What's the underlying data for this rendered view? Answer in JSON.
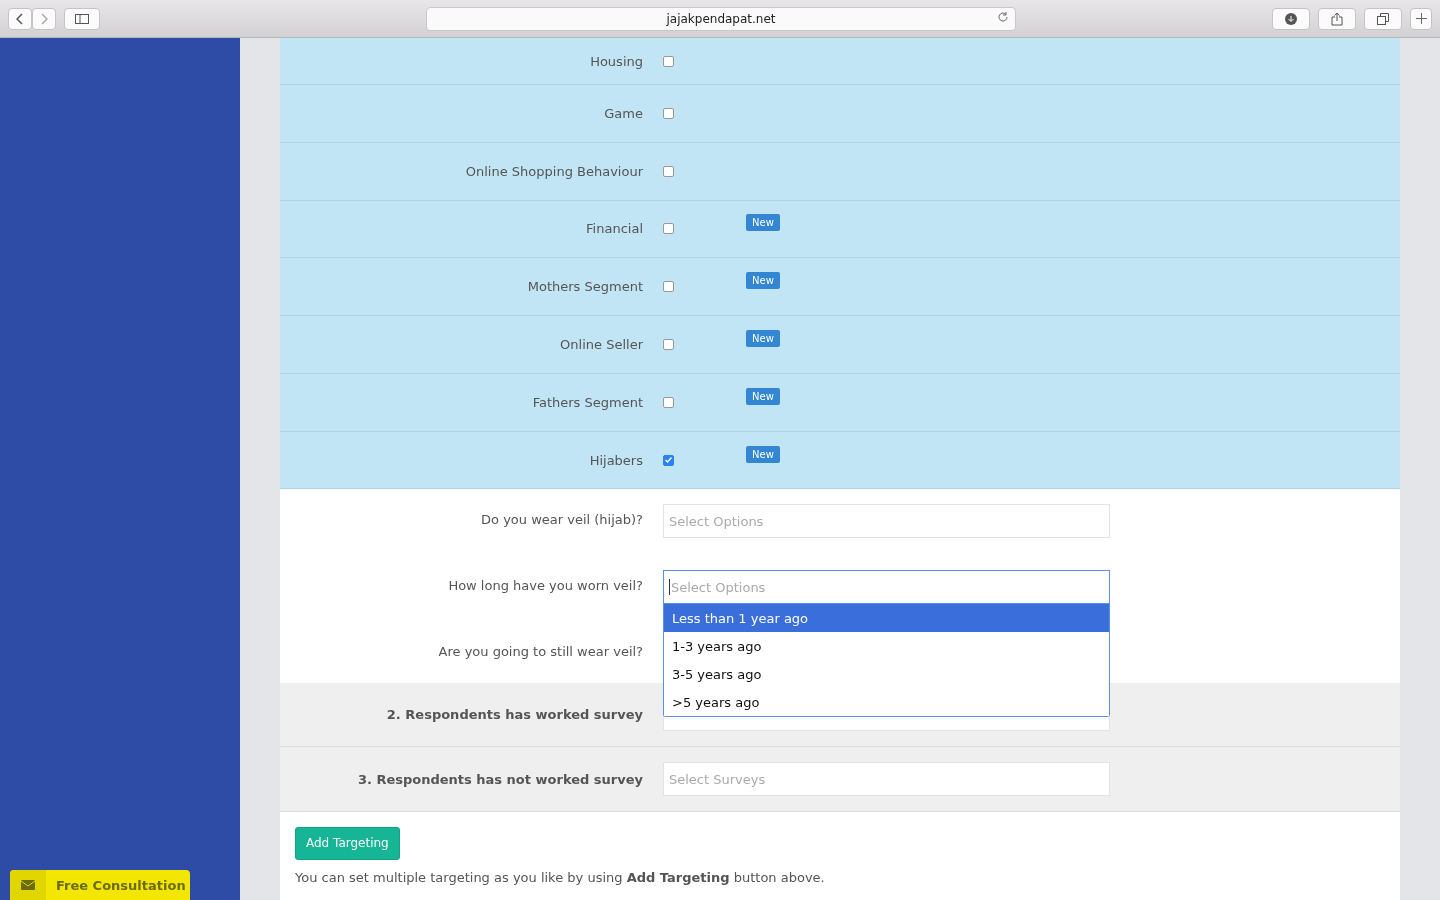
{
  "browser": {
    "address": "jajakpendapat.net"
  },
  "categories": [
    {
      "label": "Housing",
      "checked": false
    },
    {
      "label": "Game",
      "checked": false
    },
    {
      "label": "Online Shopping Behaviour",
      "checked": false
    },
    {
      "label": "Financial",
      "checked": false,
      "badge": "New"
    },
    {
      "label": "Mothers Segment",
      "checked": false,
      "badge": "New"
    },
    {
      "label": "Online Seller",
      "checked": false,
      "badge": "New"
    },
    {
      "label": "Fathers Segment",
      "checked": false,
      "badge": "New"
    },
    {
      "label": "Hijabers",
      "checked": true,
      "badge": "New"
    }
  ],
  "questions": [
    {
      "label": "Do you wear veil (hijab)?",
      "placeholder": "Select Options"
    },
    {
      "label": "How long have you worn veil?",
      "placeholder": "Select Options",
      "options": [
        {
          "label": "Less than 1 year ago",
          "selected": true
        },
        {
          "label": "1-3 years ago",
          "selected": false
        },
        {
          "label": "3-5 years ago",
          "selected": false
        },
        {
          "label": ">5 years ago",
          "selected": false
        }
      ]
    },
    {
      "label": "Are you going to still wear veil?"
    }
  ],
  "sections": [
    {
      "label": "2. Respondents has worked survey"
    },
    {
      "label": "3. Respondents has not worked survey",
      "placeholder": "Select Surveys"
    }
  ],
  "add_button": "Add Targeting",
  "hint": "You can set multiple targeting as you like by using **Add Targeting** button above.",
  "consultation_button": "Free Consultation"
}
